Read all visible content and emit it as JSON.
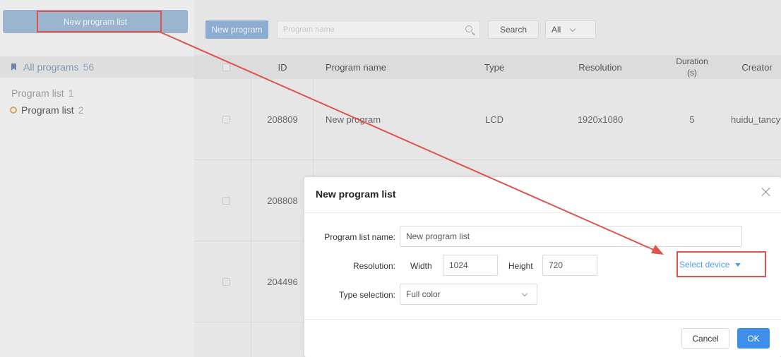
{
  "sidebar": {
    "new_list_button": "New program list",
    "all_programs": {
      "label": "All programs",
      "count": "56"
    },
    "items": [
      {
        "label": "Program list",
        "count": "1"
      },
      {
        "label": "Program list",
        "count": "2"
      }
    ]
  },
  "toolbar": {
    "new_program": "New program",
    "search_placeholder": "Program name",
    "search_button": "Search",
    "filter_value": "All"
  },
  "table": {
    "columns": [
      "ID",
      "Program name",
      "Type",
      "Resolution",
      "Duration",
      "(s)",
      "Creator"
    ],
    "rows": [
      {
        "id": "208809",
        "name": "New program",
        "type": "LCD",
        "resolution": "1920x1080",
        "duration": "5",
        "creator": "huidu_tancy"
      },
      {
        "id": "208808"
      },
      {
        "id": "204496"
      }
    ]
  },
  "modal": {
    "title": "New program list",
    "name_label": "Program list name:",
    "name_value": "New program list",
    "resolution_label": "Resolution:",
    "width_label": "Width",
    "width_value": "1024",
    "height_label": "Height",
    "height_value": "720",
    "type_label": "Type selection:",
    "type_value": "Full color",
    "select_device": "Select device",
    "cancel": "Cancel",
    "ok": "OK"
  },
  "colors": {
    "primary": "#3d8fe9",
    "annotation": "#e0534c",
    "link": "#4e9cf0"
  }
}
